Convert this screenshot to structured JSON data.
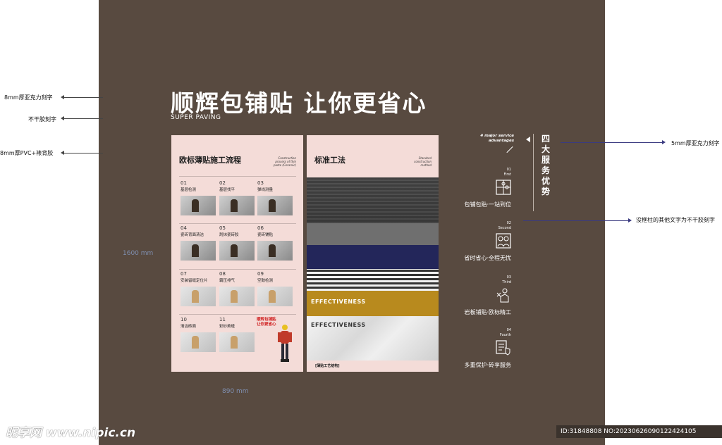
{
  "annotations": {
    "left": [
      "8mm厚亚克力刻字",
      "不干胶刻字",
      "8mm厚PVC+裱背胶"
    ],
    "right": [
      "5mm厚亚克力刻字",
      "没框柱的其他文字为不干胶刻字"
    ]
  },
  "dimensions": {
    "height": "1600 mm",
    "width": "890 mm"
  },
  "main_title": "顺辉包铺贴 让你更省心",
  "main_subtitle": "SUPER PAVING",
  "panel_left": {
    "title": "欧标薄贴施工流程",
    "en_note": "Construction process of thin paste (Ceramic)",
    "steps": [
      {
        "num": "01",
        "label": "基层检测"
      },
      {
        "num": "02",
        "label": "基层找平"
      },
      {
        "num": "03",
        "label": "弹线测量"
      },
      {
        "num": "04",
        "label": "瓷砖背面清洁"
      },
      {
        "num": "05",
        "label": "刮抹瓷砖胶"
      },
      {
        "num": "06",
        "label": "瓷砖铺贴"
      },
      {
        "num": "07",
        "label": "安装留缝定位片"
      },
      {
        "num": "08",
        "label": "霸压排气"
      },
      {
        "num": "09",
        "label": "空鼓检测"
      },
      {
        "num": "10",
        "label": "清洁砖面"
      },
      {
        "num": "11",
        "label": "彩砂美缝"
      }
    ],
    "promo": "顺辉包铺贴 让你更省心"
  },
  "panel_right": {
    "title": "标准工法",
    "en_note": "Standard construction method",
    "layer_labels": [
      "EFFECTIVENESS",
      "EFFECTIVENESS"
    ],
    "footer": "[薄贴工艺结构]"
  },
  "services": {
    "header_en": "4 major service advantages",
    "vertical_title": "四大服务优势",
    "items": [
      {
        "num": "01",
        "ord": "First",
        "text": "包铺包贴·一站到位"
      },
      {
        "num": "02",
        "ord": "Second",
        "text": "省时省心·全程无忧"
      },
      {
        "num": "03",
        "ord": "Third",
        "text": "岩板铺贴·欧标精工"
      },
      {
        "num": "04",
        "ord": "Fourth",
        "text": "多重保护·砖享服务"
      }
    ]
  },
  "watermark": {
    "site": "昵享网 www.nipic.cn",
    "id": "ID:31848808 NO:20230626090122424105"
  }
}
